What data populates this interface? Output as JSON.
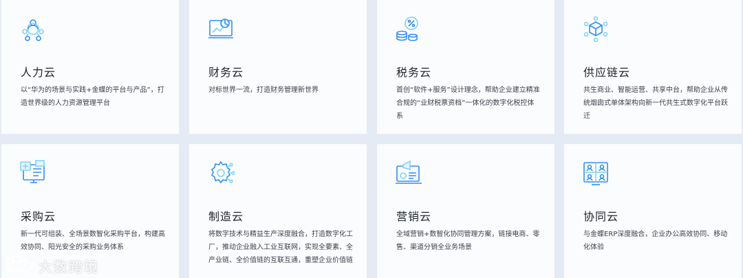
{
  "cards": [
    {
      "title": "人力云",
      "desc": "以“华为的场景与实践+金蝶的平台与产品”，打造世界级的人力资源管理平台",
      "icon": "people-network-icon"
    },
    {
      "title": "财务云",
      "desc": "对标世界一流，打造财务管理新世界",
      "icon": "finance-chart-icon"
    },
    {
      "title": "税务云",
      "desc": "首创“软件+服务”设计理念，帮助企业建立精准合规的“业财税票资档”一体化的数字化税控体系",
      "icon": "tax-coins-icon"
    },
    {
      "title": "供应链云",
      "desc": "共生商业、智能运营、共享中台，帮助企业从传统烟囱式单体架构向新一代共生式数字化平台跃迁",
      "icon": "supply-chain-cube-icon"
    },
    {
      "title": "采购云",
      "desc": "新一代可组装、全场景数智化采购平台，构建高效协同、阳光安全的采购业务体系",
      "icon": "procurement-screen-icon"
    },
    {
      "title": "制造云",
      "desc": "将数字技术与精益生产深度融合，打造数字化工厂，推动企业融入工业互联网，实现全要素、全产业链、全价值链的互联互通，重塑企业价值链",
      "icon": "manufacturing-gear-icon"
    },
    {
      "title": "营销云",
      "desc": "全域营销+数智化协同管理方案，链接电商、零售、渠道分销全业务场景",
      "icon": "marketing-megaphone-icon"
    },
    {
      "title": "协同云",
      "desc": "与金蝶ERP深度融合，企业办公高效协同、移动化体验",
      "icon": "collaboration-video-icon"
    }
  ],
  "watermark": {
    "text": "大数跨境",
    "icon": "wechat-logo-icon"
  },
  "colors": {
    "accent": "#2f8ff0",
    "accent_light": "#7dd3f4",
    "background": "#e4ebf4",
    "card": "#fbfcfe"
  }
}
